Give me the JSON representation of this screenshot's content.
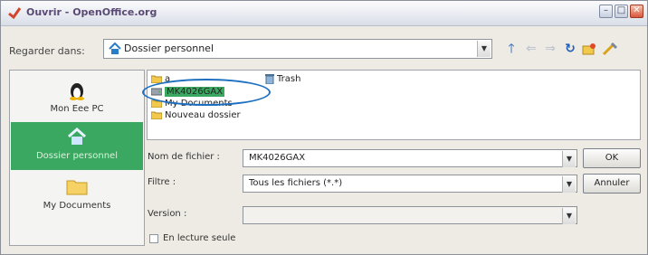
{
  "window": {
    "title": "Ouvrir - OpenOffice.org",
    "minimize": "–",
    "maximize": "□",
    "close": "✕"
  },
  "lookin": {
    "label": "Regarder dans:",
    "value": "Dossier personnel"
  },
  "places": [
    {
      "label": "Mon Eee PC",
      "icon": "linux-penguin-icon"
    },
    {
      "label": "Dossier personnel",
      "icon": "home-icon",
      "selected": true
    },
    {
      "label": "My Documents",
      "icon": "folder-icon"
    }
  ],
  "files": [
    {
      "name": "a",
      "icon": "folder-icon"
    },
    {
      "name": "MK4026GAX",
      "icon": "drive-icon",
      "selected": true
    },
    {
      "name": "My Documents",
      "icon": "folder-icon"
    },
    {
      "name": "Nouveau dossier",
      "icon": "folder-icon"
    },
    {
      "name": "Trash",
      "icon": "trash-icon"
    }
  ],
  "form": {
    "filename_label": "Nom de fichier :",
    "filename_value": "MK4026GAX",
    "filter_label": "Filtre :",
    "filter_value": "Tous les fichiers (*.*)",
    "version_label": "Version :",
    "version_value": "",
    "readonly_label": "En lecture seule"
  },
  "buttons": {
    "ok": "OK",
    "cancel": "Annuler"
  },
  "colors": {
    "selection": "#3aa860",
    "annotation": "#1c6fc0"
  }
}
